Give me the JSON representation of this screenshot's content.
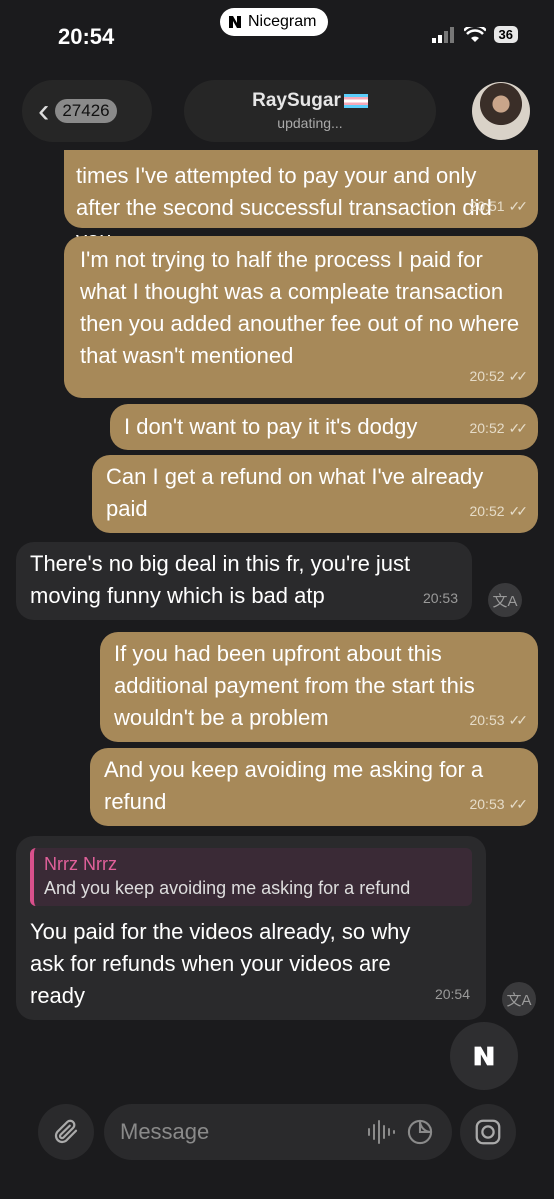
{
  "status_bar": {
    "time": "20:54",
    "carrier": "Nicegram",
    "battery": "36"
  },
  "header": {
    "back_count": "27426",
    "name": "RaySugar",
    "status": "updating..."
  },
  "messages": [
    {
      "dir": "out",
      "text": "times I've attempted to pay your and only after the second successful transaction did you",
      "time": "20:51"
    },
    {
      "dir": "out",
      "text": "I'm not trying to half the process I paid for what I thought was a compleate transaction then you added anouther fee out of no where that wasn't mentioned",
      "time": "20:52"
    },
    {
      "dir": "out",
      "text": "I don't want to pay it it's dodgy",
      "time": "20:52"
    },
    {
      "dir": "out",
      "text": "Can I get a refund on what I've already paid",
      "time": "20:52"
    },
    {
      "dir": "in",
      "text": "There's no big deal in this fr, you're just moving funny which is bad atp",
      "time": "20:53"
    },
    {
      "dir": "out",
      "text": "If you had been upfront about this additional payment from the start this wouldn't be a problem",
      "time": "20:53"
    },
    {
      "dir": "out",
      "text": "And you keep avoiding me asking for a refund",
      "time": "20:53"
    },
    {
      "dir": "in",
      "reply_name": "Nrrz Nrrz",
      "reply_text": "And you keep avoiding me asking for a refund",
      "text": "You paid for the videos already, so why ask for refunds when your videos are ready",
      "time": "20:54"
    }
  ],
  "input": {
    "placeholder": "Message"
  },
  "icons": {
    "attach": "paperclip-icon",
    "voice": "waveform-icon",
    "sticker": "sticker-icon",
    "camera": "camera-icon",
    "translate": "translate-icon"
  },
  "colors": {
    "outgoing_bubble": "#a78959",
    "incoming_bubble": "#2a2a2c",
    "reply_accent": "#d9508c"
  }
}
